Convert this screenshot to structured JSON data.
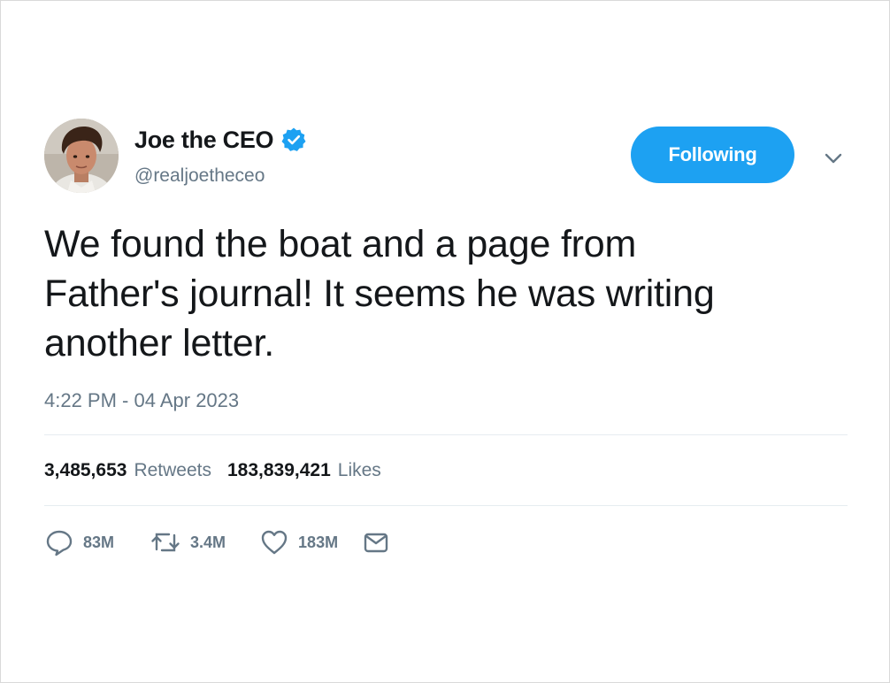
{
  "user": {
    "display_name": "Joe the CEO",
    "handle": "@realjoetheceo",
    "verified": true,
    "verified_icon": "verified-badge-icon",
    "avatar": "profile-photo"
  },
  "follow_button": {
    "label": "Following",
    "color": "#1da1f2"
  },
  "menu": {
    "icon": "chevron-down-icon"
  },
  "tweet": {
    "text": "We found the boat and a page from\nFather's journal! It seems he was writing\nanother letter.",
    "timestamp": "4:22 PM - 04 Apr 2023"
  },
  "stats": {
    "retweets_count": "3,485,653",
    "retweets_label": "Retweets",
    "likes_count": "183,839,421",
    "likes_label": "Likes"
  },
  "actions": {
    "reply": {
      "icon": "reply-icon",
      "count": "83M"
    },
    "retweet": {
      "icon": "retweet-icon",
      "count": "3.4M"
    },
    "like": {
      "icon": "heart-icon",
      "count": "183M"
    },
    "message": {
      "icon": "envelope-icon"
    }
  },
  "colors": {
    "text_primary": "#14171a",
    "text_secondary": "#657786",
    "accent": "#1da1f2",
    "divider": "#e6ecf0"
  }
}
